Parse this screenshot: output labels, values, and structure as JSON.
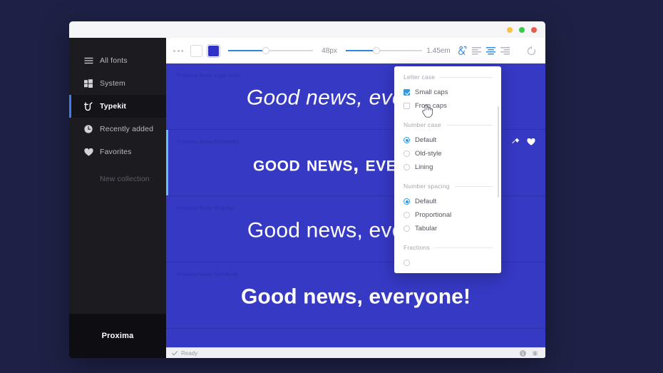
{
  "window": {
    "traffic_lights": [
      "yellow",
      "green",
      "red"
    ]
  },
  "sidebar": {
    "items": [
      {
        "label": "All fonts",
        "icon": "hamburger-icon",
        "active": false
      },
      {
        "label": "System",
        "icon": "windows-icon",
        "active": false
      },
      {
        "label": "Typekit",
        "icon": "typekit-icon",
        "active": true
      },
      {
        "label": "Recently added",
        "icon": "clock-icon",
        "active": false
      },
      {
        "label": "Favorites",
        "icon": "heart-icon",
        "active": false
      }
    ],
    "new_collection_label": "New collection",
    "footer_label": "Proxima"
  },
  "toolbar": {
    "more_label": "•••",
    "swatch_white": "#ffffff",
    "swatch_blue": "#2f31c7",
    "font_size_value": "48px",
    "line_height_value": "1.45em",
    "ligature_icon": "ampersand-icon",
    "align_left_icon": "align-left-icon",
    "align_center_icon": "align-center-icon",
    "align_right_icon": "align-right-icon",
    "reset_icon": "reset-icon",
    "align_active": "center",
    "ligature_active": true,
    "accent_color": "#3c8ede"
  },
  "preview": {
    "background": "#3639c4",
    "selection_accent": "#5ec3ef",
    "rows": [
      {
        "label": "Proxima Nova Light Italic",
        "text": "Good news, everyone!",
        "selected": false,
        "actions": []
      },
      {
        "label": "Proxima Nova Extrabold",
        "text": "Good news, everyone!",
        "selected": true,
        "actions": [
          "pin-icon",
          "heart-icon"
        ]
      },
      {
        "label": "Proxima Nova Regular",
        "text": "Good news, everyone!",
        "selected": false,
        "actions": []
      },
      {
        "label": "Proxima Nova Semibold",
        "text": "Good news, everyone!",
        "selected": false,
        "actions": []
      }
    ]
  },
  "statusbar": {
    "check_icon": "check-icon",
    "status_text": "Ready",
    "info_icon": "info-icon",
    "bug_icon": "bug-icon"
  },
  "panel": {
    "groups": [
      {
        "title": "Letter case",
        "control": "checkbox",
        "options": [
          {
            "label": "Small caps",
            "checked": true
          },
          {
            "label": "From caps",
            "checked": false
          }
        ]
      },
      {
        "title": "Number case",
        "control": "radio",
        "options": [
          {
            "label": "Default",
            "checked": true
          },
          {
            "label": "Old-style",
            "checked": false
          },
          {
            "label": "Lining",
            "checked": false
          }
        ]
      },
      {
        "title": "Number spacing",
        "control": "radio",
        "options": [
          {
            "label": "Default",
            "checked": true
          },
          {
            "label": "Proportional",
            "checked": false
          },
          {
            "label": "Tabular",
            "checked": false
          }
        ]
      },
      {
        "title": "Fractions",
        "control": "radio",
        "options": []
      }
    ],
    "accent_color": "#2e9ae8"
  }
}
